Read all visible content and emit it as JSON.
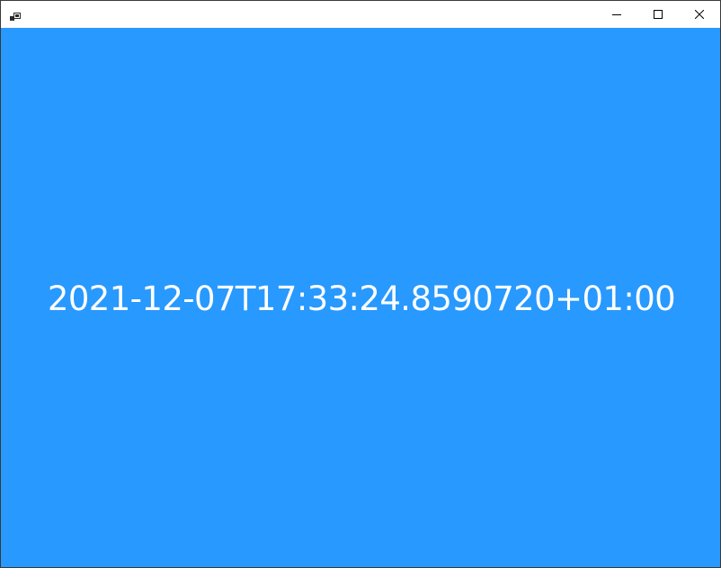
{
  "window": {
    "title": "",
    "icon": "app-icon",
    "controls": [
      "minimize-icon",
      "maximize-icon",
      "close-icon"
    ]
  },
  "content": {
    "text": "2021-12-07T17:33:24.8590720+01:00",
    "background_color": "#2899fe",
    "text_color": "#ffffff"
  }
}
